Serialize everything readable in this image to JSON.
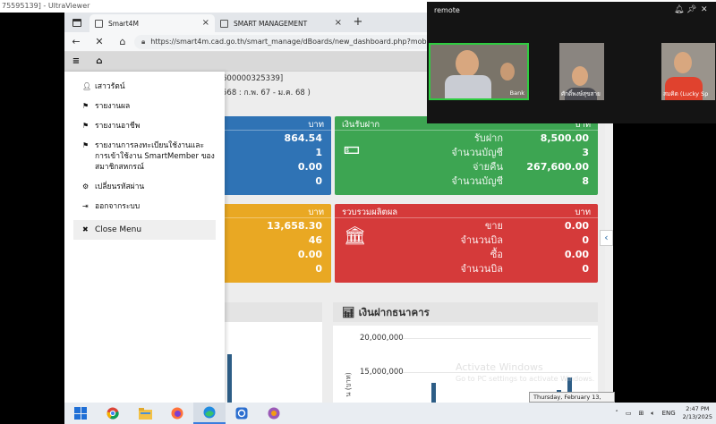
{
  "ultraviewer": {
    "title": "75595139] - UltraViewer"
  },
  "browser": {
    "tabs": [
      {
        "label": "Smart4M",
        "close": "×"
      },
      {
        "label": "SMART MANAGEMENT",
        "close": "×"
      }
    ],
    "new_tab": "+",
    "url": "https://smart4m.cad.go.th/smart_manage/dBoards/new_dashboard.php?mobile"
  },
  "page": {
    "info_line_1": "600000325339]",
    "info_line_2": "568 : ก.พ. 67 - ม.ค. 68 )",
    "menu": [
      {
        "icon": "user-icon",
        "label": "เสาวรัตน์"
      },
      {
        "icon": "flag-icon",
        "label": "รายงานผล"
      },
      {
        "icon": "flag-icon",
        "label": "รายงานอาชีพ"
      },
      {
        "icon": "flag-icon",
        "label": "รายงานการลงทะเบียนใช้งานและการเข้าใช้งาน SmartMember ของสมาชิกสหกรณ์"
      },
      {
        "icon": "gear-icon",
        "label": "เปลี่ยนรหัสผ่าน"
      },
      {
        "icon": "logout-icon",
        "label": "ออกจากระบบ"
      }
    ],
    "close_menu": "Close Menu",
    "cards": {
      "blue": {
        "unit": "บาท",
        "values": [
          "864.54",
          "1",
          "0.00",
          "0"
        ]
      },
      "deposit": {
        "title": "เงินรับฝาก",
        "unit": "บาท",
        "rows": [
          {
            "label": "รับฝาก",
            "value": "8,500.00"
          },
          {
            "label": "จำนวนบัญชี",
            "value": "3"
          },
          {
            "label": "จ่ายคืน",
            "value": "267,600.00"
          },
          {
            "label": "จำนวนบัญชี",
            "value": "8"
          }
        ]
      },
      "yellow": {
        "unit": "บาท",
        "values": [
          "13,658.30",
          "46",
          "0.00",
          "0"
        ]
      },
      "products": {
        "title": "รวบรวมผลิตผล",
        "unit": "บาท",
        "rows": [
          {
            "label": "ขาย",
            "value": "0.00"
          },
          {
            "label": "จำนวนบิล",
            "value": "0"
          },
          {
            "label": "ซื้อ",
            "value": "0.00"
          },
          {
            "label": "จำนวนบิล",
            "value": "0"
          }
        ]
      }
    },
    "bank_panel": {
      "title": "เงินฝากธนาคาร",
      "ticks": [
        "20,000,000",
        "15,000,000"
      ],
      "ylabel": "น (บาท)"
    }
  },
  "remote": {
    "title": "remote",
    "participants": [
      {
        "name": "Bank",
        "active": true
      },
      {
        "name": "ศักดิ์พงษ์สุขสาย",
        "active": false
      },
      {
        "name": "สมคิด (Lucky Sp",
        "active": false
      }
    ]
  },
  "watermark": {
    "line1": "Activate Windows",
    "line2": "Go to PC settings to activate Windows."
  },
  "tooltip_date": "Thursday, February 13, 2025",
  "taskbar": {
    "lang": "ENG",
    "time": "2:47 PM",
    "date": "2/13/2025"
  },
  "colors": {
    "blue_card": "#2f73b5",
    "green_card": "#3da552",
    "yellow_card": "#e9a823",
    "red_card": "#d53a3a",
    "bar": "#2d5d86"
  }
}
